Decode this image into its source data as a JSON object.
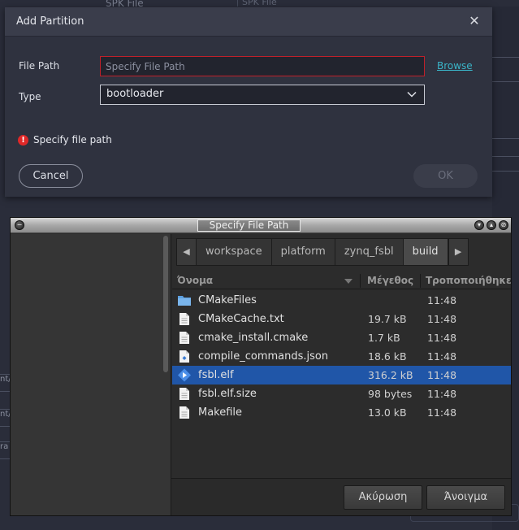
{
  "background": {
    "top_label": "SPK File",
    "top_label2": "SPK File",
    "left_fragments": [
      "nt/",
      "nt/",
      "ra"
    ]
  },
  "add_partition": {
    "title": "Add Partition",
    "close_icon": "close-icon",
    "file_path_label": "File Path",
    "file_path_placeholder": "Specify File Path",
    "browse_label": "Browse",
    "type_label": "Type",
    "type_value": "bootloader",
    "error_text": "Specify file path",
    "cancel_label": "Cancel",
    "ok_label": "OK",
    "error_color": "#e02828",
    "link_color": "#3ab5c8"
  },
  "file_chooser": {
    "title": "Specify File Path",
    "path_crumbs": [
      "workspace",
      "platform",
      "zynq_fsbl",
      "build"
    ],
    "columns": {
      "name": "Όνομα",
      "size": "Μέγεθος",
      "modified": "Τροποποιήθηκε"
    },
    "files": [
      {
        "name": "CMakeFiles",
        "size": "",
        "modified": "11:48",
        "icon": "folder-icon"
      },
      {
        "name": "CMakeCache.txt",
        "size": "19.7 kB",
        "modified": "11:48",
        "icon": "file-icon"
      },
      {
        "name": "cmake_install.cmake",
        "size": "1.7 kB",
        "modified": "11:48",
        "icon": "file-icon"
      },
      {
        "name": "compile_commands.json",
        "size": "18.6 kB",
        "modified": "11:48",
        "icon": "json-file-icon"
      },
      {
        "name": "fsbl.elf",
        "size": "316.2 kB",
        "modified": "11:48",
        "icon": "executable-icon",
        "selected": true
      },
      {
        "name": "fsbl.elf.size",
        "size": "98 bytes",
        "modified": "11:48",
        "icon": "file-icon"
      },
      {
        "name": "Makefile",
        "size": "13.0 kB",
        "modified": "11:48",
        "icon": "file-icon"
      }
    ],
    "cancel_label": "Ακύρωση",
    "open_label": "Άνοιγμα",
    "selection_color": "#2056a8"
  }
}
